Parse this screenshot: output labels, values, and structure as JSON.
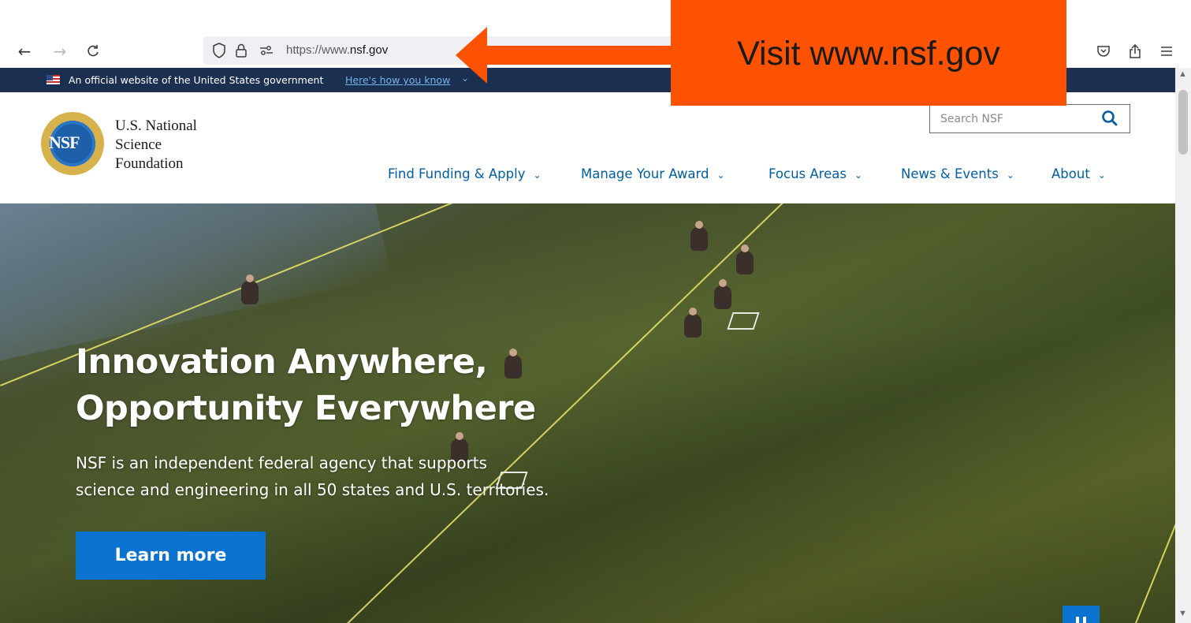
{
  "browser": {
    "url_prefix": "https://www.",
    "url_domain": "nsf.gov"
  },
  "gov_banner": {
    "text": "An official website of the United States government",
    "link": "Here's how you know",
    "chevron": "⌄"
  },
  "header": {
    "logo_seal_text": "NSF",
    "logo_line1": "U.S. National",
    "logo_line2": "Science",
    "logo_line3": "Foundation",
    "search_placeholder": "Search NSF",
    "nav": [
      {
        "label": "Find Funding & Apply"
      },
      {
        "label": "Manage Your Award"
      },
      {
        "label": "Focus Areas"
      },
      {
        "label": "News & Events"
      },
      {
        "label": "About"
      }
    ],
    "nav_chevron": "⌄"
  },
  "hero": {
    "title_line1": "Innovation Anywhere,",
    "title_line2": "Opportunity Everywhere",
    "description_line1": "NSF is an independent federal agency that supports",
    "description_line2": "science and engineering in all 50 states and U.S. territories.",
    "button": "Learn more"
  },
  "annotation": {
    "text": "Visit www.nsf.gov"
  },
  "colors": {
    "accent": "#fd5201",
    "nav_link": "#005ea2",
    "gov_banner_bg": "#1b2f50",
    "button_blue": "#0a73cf"
  }
}
